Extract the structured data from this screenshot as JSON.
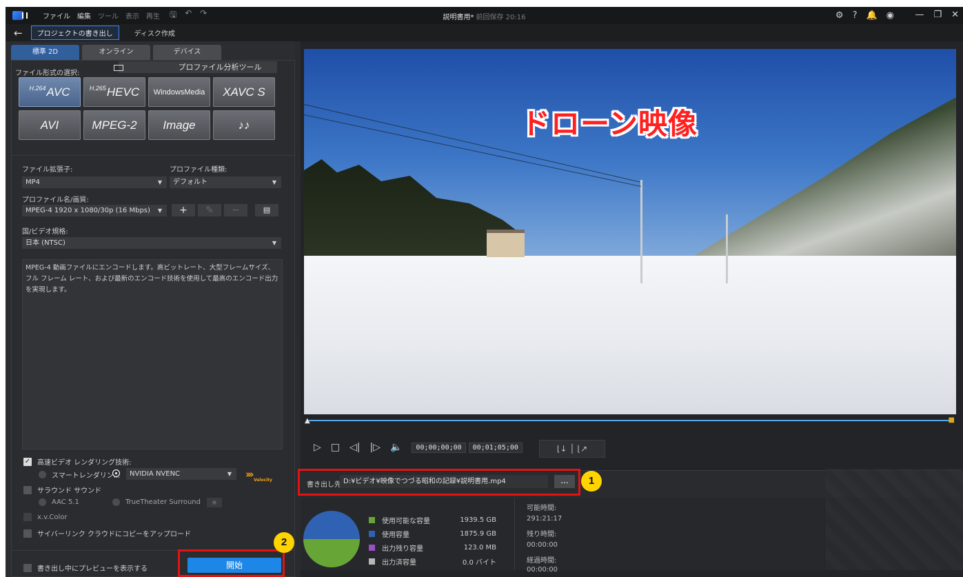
{
  "titlebar": {
    "menus": [
      "ファイル",
      "編集",
      "ツール",
      "表示",
      "再生"
    ],
    "doc_title": "説明書用*",
    "saved_info": "前回保存 20:16"
  },
  "subbar": {
    "active_tab": "プロジェクトの書き出し",
    "other_tab": "ディスク作成"
  },
  "mode_tabs": [
    "標準 2D",
    "オンライン",
    "デバイス"
  ],
  "format": {
    "label": "ファイル形式の選択:",
    "profile_tool": "プロファイル分析ツール",
    "buttons": [
      {
        "sup": "H.264",
        "label": "AVC",
        "selected": true
      },
      {
        "sup": "H.265",
        "label": "HEVC",
        "selected": false
      },
      {
        "sup": "",
        "label": "WindowsMedia",
        "selected": false
      },
      {
        "sup": "",
        "label": "XAVC S",
        "selected": false
      },
      {
        "sup": "",
        "label": "AVI",
        "selected": false
      },
      {
        "sup": "",
        "label": "MPEG-2",
        "selected": false
      },
      {
        "sup": "",
        "label": "Image",
        "selected": false
      },
      {
        "sup": "",
        "label": "♪♪",
        "selected": false
      }
    ]
  },
  "settings": {
    "ext_label": "ファイル拡張子:",
    "ext_value": "MP4",
    "profile_type_label": "プロファイル種類:",
    "profile_type_value": "デフォルト",
    "profile_name_label": "プロファイル名/画質:",
    "profile_name_value": "MPEG-4 1920 x 1080/30p (16 Mbps)",
    "region_label": "国/ビデオ規格:",
    "region_value": "日本 (NTSC)",
    "description": "MPEG-4 動画ファイルにエンコードします。高ビットレート、大型フレームサイズ、フル フレーム レート、および最新のエンコード技術を使用して最高のエンコード出力を実現します。"
  },
  "options": {
    "fast_render": "高速ビデオ レンダリング技術:",
    "smart_render": "スマートレンダリン...",
    "encoder": "NVIDIA NVENC",
    "velocity": "Velocity",
    "surround": "サラウンド サウンド",
    "aac": "AAC 5.1",
    "truetheater": "TrueTheater Surround",
    "xvcolor": "x.v.Color",
    "cyberlink": "サイバーリンク クラウドにコピーをアップロード",
    "preview_during": "書き出し中にプレビューを表示する",
    "start": "開始"
  },
  "preview": {
    "overlay_text": "ドローン映像"
  },
  "player": {
    "timecode_current": "00;00;00;00",
    "timecode_total": "00;01;05;00"
  },
  "destination": {
    "label": "書き出し先:",
    "path": "D:¥ビデオ¥映像でつづる昭和の記録¥説明書用.mp4",
    "browse": "..."
  },
  "storage": {
    "rows": [
      {
        "label": "使用可能な容量",
        "value": "1939.5 GB",
        "color": "#67a636"
      },
      {
        "label": "使用容量",
        "value": "1875.9 GB",
        "color": "#2f62b3"
      },
      {
        "label": "出力残り容量",
        "value": "123.0 MB",
        "color": "#9b4fc4"
      },
      {
        "label": "出力済容量",
        "value": "0.0 バイト",
        "color": "#b8b8b8"
      }
    ]
  },
  "times": {
    "available_label": "可能時間:",
    "available_value": "291:21:17",
    "remaining_label": "残り時間:",
    "remaining_value": "00:00:00",
    "elapsed_label": "経過時間:",
    "elapsed_value": "00:00:00"
  },
  "annotations": {
    "badge1": "1",
    "badge2": "2"
  }
}
